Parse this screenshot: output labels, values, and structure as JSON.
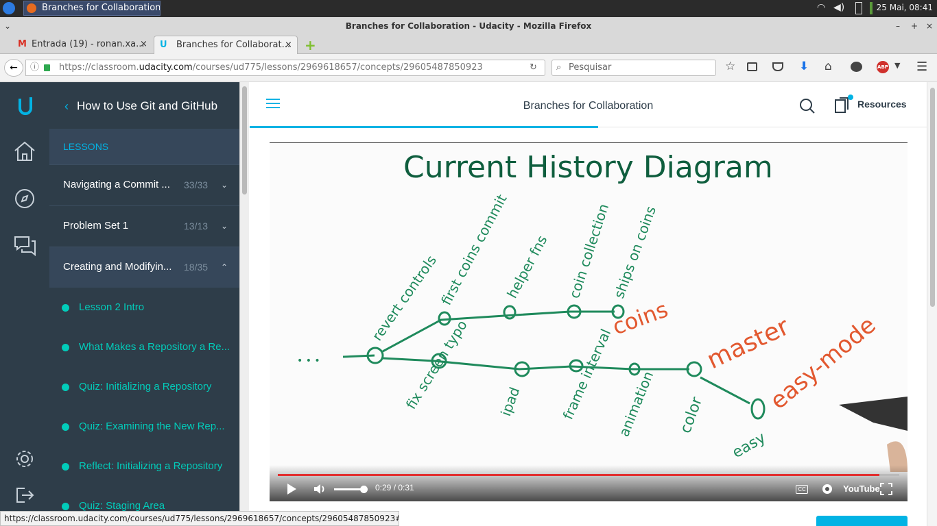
{
  "system": {
    "task_label": "Branches for Collaboration...",
    "clock": "25 Mai, 08:41"
  },
  "browser": {
    "window_title": "Branches for Collaboration - Udacity - Mozilla Firefox",
    "tabs": [
      {
        "label": "Entrada (19) - ronan.xa...",
        "icon": "gmail-icon"
      },
      {
        "label": "Branches for Collaborat...",
        "icon": "udacity-icon"
      }
    ],
    "url_prefix": "https://classroom.",
    "url_domain": "udacity.com",
    "url_path": "/courses/ud775/lessons/2969618657/concepts/29605487850923",
    "search_placeholder": "Pesquisar",
    "status_url": "https://classroom.udacity.com/courses/ud775/lessons/2969618657/concepts/29605487850923#"
  },
  "sidebar": {
    "course_title": "How to Use Git and GitHub",
    "lessons_header": "LESSONS",
    "lessons": [
      {
        "title": "Navigating a Commit ...",
        "count": "33/33",
        "chevron": "⌄"
      },
      {
        "title": "Problem Set 1",
        "count": "13/13",
        "chevron": "⌄"
      },
      {
        "title": "Creating and Modifyin...",
        "count": "18/35",
        "chevron": "⌃"
      }
    ],
    "concepts": [
      "Lesson 2 Intro",
      "What Makes a Repository a Re...",
      "Quiz: Initializing a Repository",
      "Quiz: Examining the New Rep...",
      "Reflect: Initializing a Repository",
      "Quiz: Staging Area"
    ]
  },
  "main": {
    "page_title": "Branches for Collaboration",
    "resources_label": "Resources"
  },
  "video": {
    "diagram_title": "Current History Diagram",
    "ellipsis": "• • •",
    "top_commits": [
      "revert controls",
      "first coins commit",
      "helper fns",
      "coin collection",
      "ships on coins"
    ],
    "bottom_commits": [
      "fix screen typo",
      "ipad",
      "frame interval",
      "animation",
      "color"
    ],
    "easy_commit": "easy",
    "branch_coins": "coins",
    "branch_master": "master",
    "branch_easy": "easy-mode",
    "time": "0:29 / 0:31",
    "played_fraction": 0.968,
    "volume_fraction": 0.86,
    "youtube": "YouTube",
    "colors": {
      "ink": "#1f8a5c",
      "branch": "#e2582f",
      "progress": "#e22f2f"
    }
  }
}
